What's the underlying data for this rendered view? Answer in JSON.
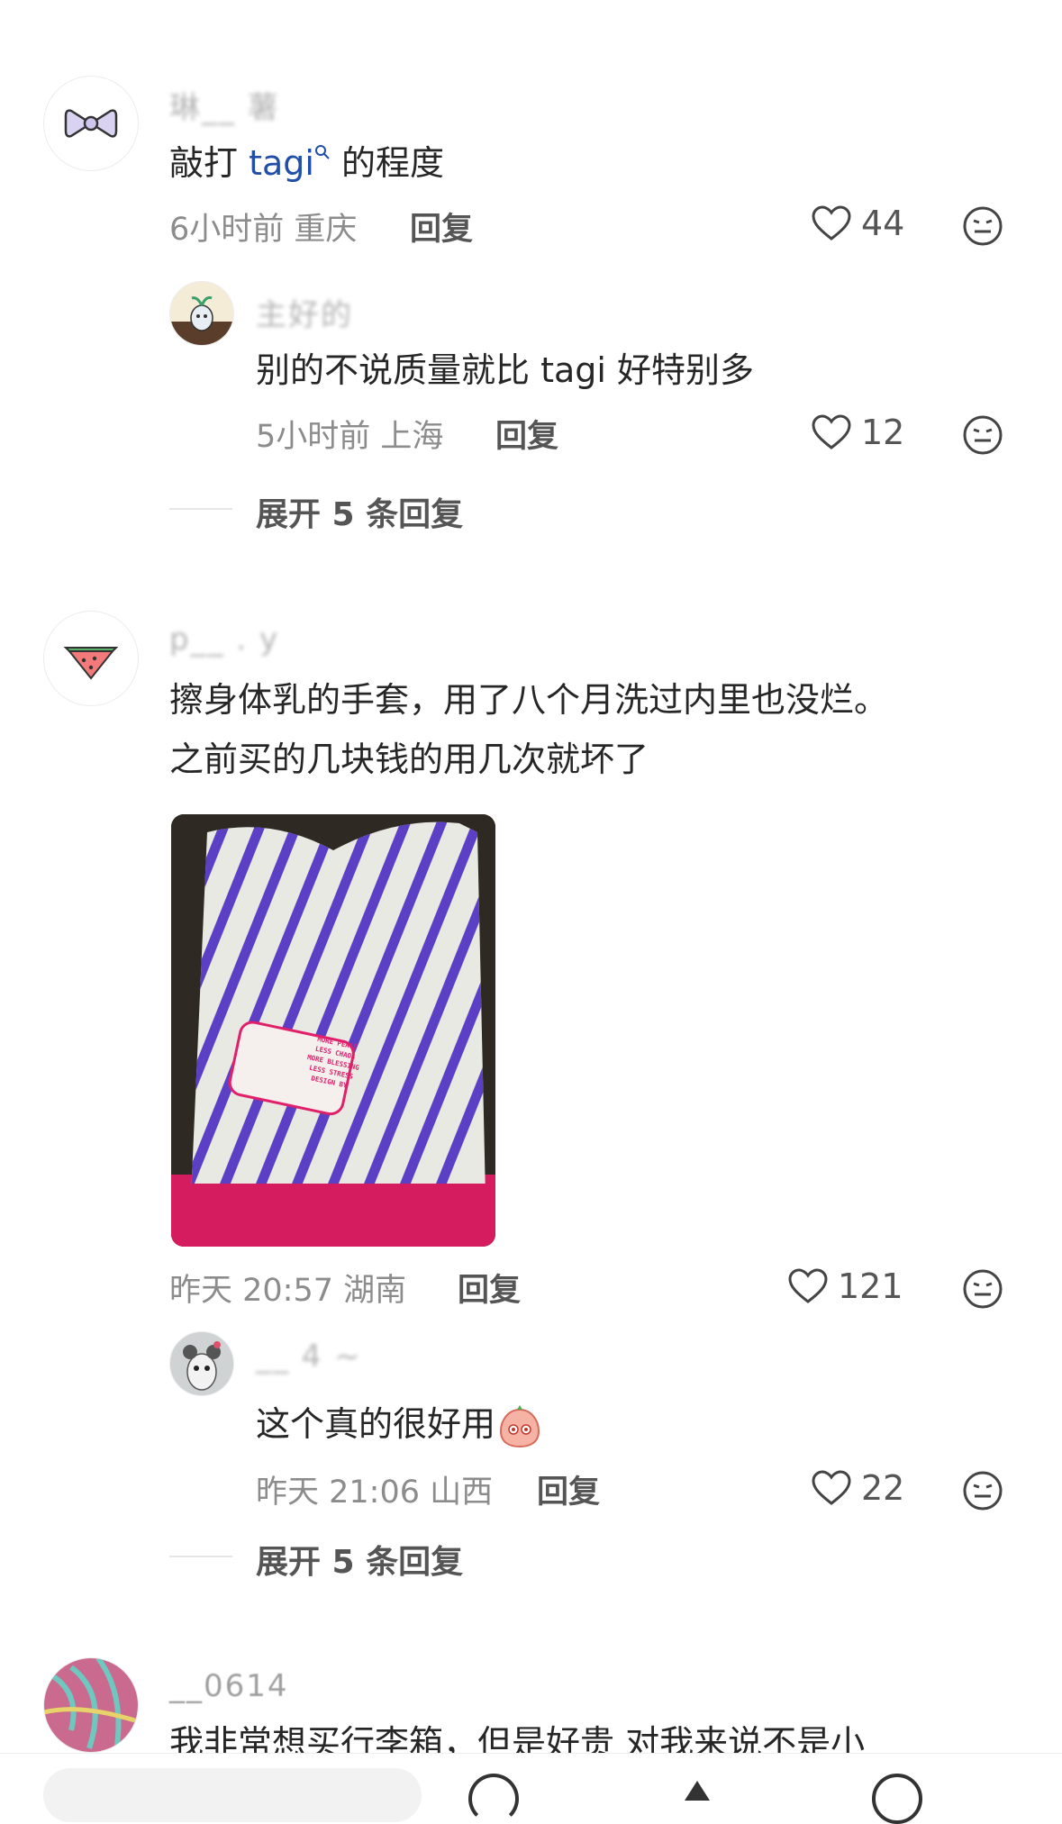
{
  "comments": [
    {
      "username": "琳__ 薯",
      "text_before": "敲打 ",
      "link": "tagi",
      "text_after": " 的程度",
      "time": "6小时前 重庆",
      "reply": "回复",
      "likes": "44",
      "replies": [
        {
          "username": "主好的",
          "text": "别的不说质量就比 tagi 好特别多",
          "time": "5小时前 上海",
          "reply": "回复",
          "likes": "12"
        }
      ],
      "expand": "展开 5 条回复"
    },
    {
      "username": "p__ . y",
      "text_line1": "擦身体乳的手套，用了八个月洗过内里也没烂。",
      "text_line2": "之前买的几块钱的用几次就坏了",
      "image_label": [
        "MORE PEACE",
        "LESS CHAOS",
        "MORE BLESSING",
        "LESS STRESS",
        "DESIGN BY"
      ],
      "time": "昨天 20:57 湖南",
      "reply": "回复",
      "likes": "121",
      "replies": [
        {
          "username": "__ 4 ~",
          "text": "这个真的很好用",
          "time": "昨天 21:06 山西",
          "reply": "回复",
          "likes": "22"
        }
      ],
      "expand": "展开 5 条回复"
    },
    {
      "username": "__0614",
      "text": "我非常想买行李箱，但是好贵 对我来说不是小"
    }
  ],
  "icons": {
    "like": "heart-outline-icon",
    "react": "emoji-face-icon",
    "search_link": "search-icon"
  },
  "colors": {
    "link": "#1f4fa8",
    "meta": "#8c8c8c",
    "stripe": "#5b3fc4",
    "cuff": "#e0206a"
  }
}
